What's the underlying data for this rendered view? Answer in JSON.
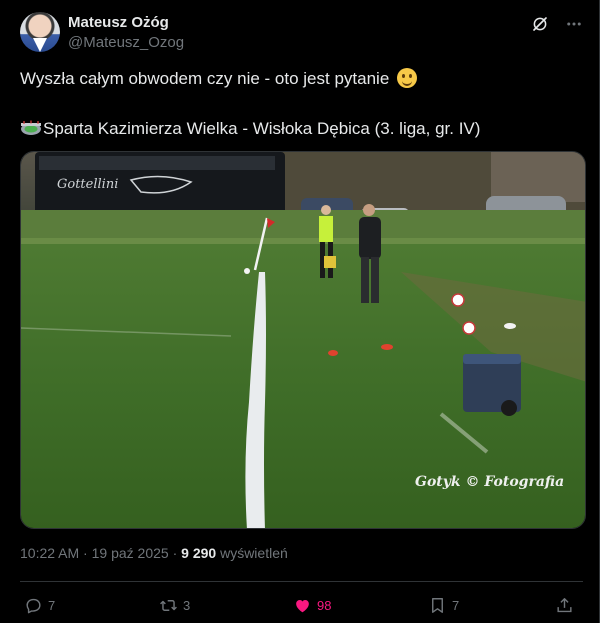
{
  "author": {
    "display_name": "Mateusz Ożóg",
    "handle": "@Mateusz_Ozog"
  },
  "tweet": {
    "line1": "Wyszła całym obwodem czy nie - oto jest pytanie",
    "line2": "Sparta Kazimierza Wielka - Wisłoka Dębica (3. liga, gr. IV)"
  },
  "media": {
    "watermark": "Gotyk © Fotografia",
    "bus_lettering": "Gottellini"
  },
  "meta": {
    "time": "10:22 AM",
    "separator": "·",
    "date": "19 paź 2025",
    "views_count": "9 290",
    "views_label": "wyświetleń"
  },
  "actions": {
    "replies": "7",
    "reposts": "3",
    "likes": "98",
    "bookmarks": "7"
  },
  "colors": {
    "background": "#000000",
    "text": "#e7e9ea",
    "muted": "#71767b",
    "like": "#f91880",
    "border": "#2f3336"
  },
  "icons": {
    "grok": "grok-icon",
    "more": "more-icon",
    "reply": "reply-icon",
    "repost": "repost-icon",
    "like": "heart-icon",
    "bookmark": "bookmark-icon",
    "share": "share-icon"
  }
}
